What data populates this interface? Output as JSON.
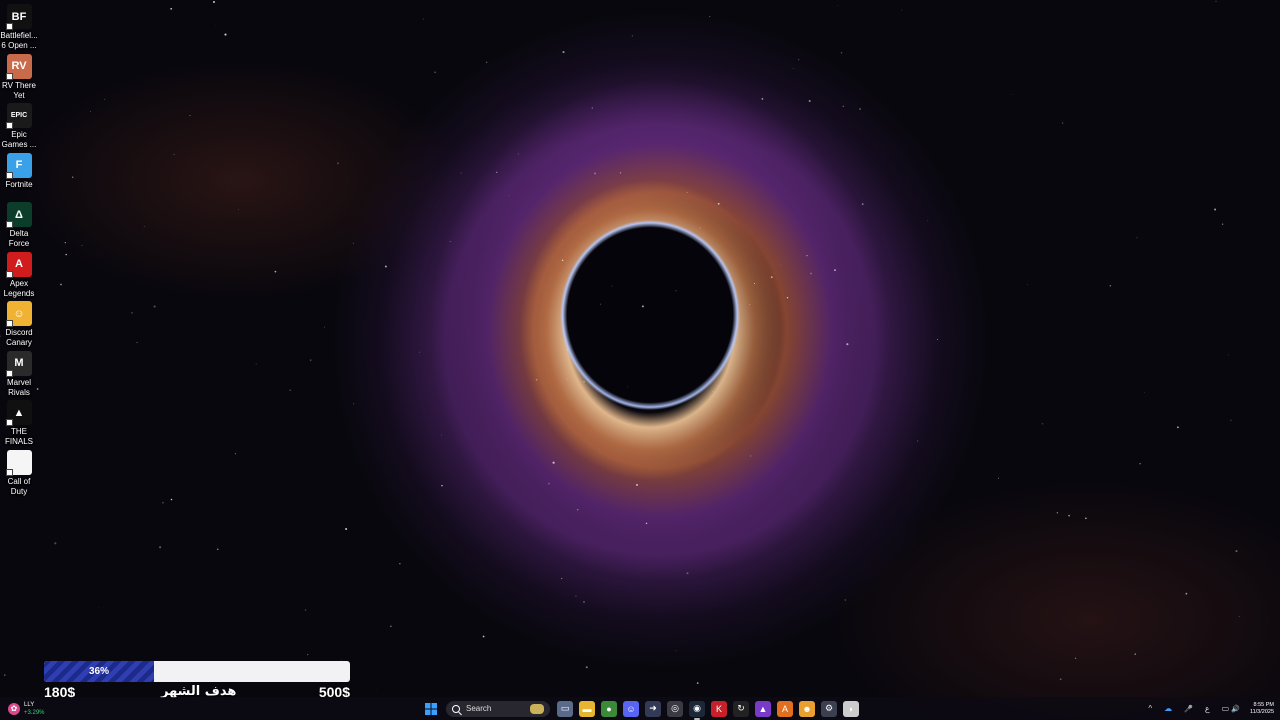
{
  "desktop": {
    "icons": [
      {
        "label": "Battlefiel...\n6 Open ...",
        "glyph": "BF",
        "color": "#111111",
        "icon": "battlefield-icon"
      },
      {
        "label": "RV There\nYet",
        "glyph": "RV",
        "color": "#c86b4a",
        "icon": "rv-there-yet-icon"
      },
      {
        "label": "Epic\nGames ...",
        "glyph": "EPIC",
        "color": "#1a1a1a",
        "icon": "epic-games-icon"
      },
      {
        "label": "Fortnite",
        "glyph": "F",
        "color": "#3aa0e8",
        "icon": "fortnite-icon"
      },
      {
        "label": "Delta\nForce",
        "glyph": "Δ",
        "color": "#0b3d2a",
        "icon": "delta-force-icon"
      },
      {
        "label": "Apex\nLegends",
        "glyph": "A",
        "color": "#d01c1c",
        "icon": "apex-legends-icon"
      },
      {
        "label": "Discord\nCanary",
        "glyph": "☺",
        "color": "#f0b232",
        "icon": "discord-canary-icon"
      },
      {
        "label": "Marvel\nRivals",
        "glyph": "M",
        "color": "#2a2a2a",
        "icon": "marvel-rivals-icon"
      },
      {
        "label": "THE\nFINALS",
        "glyph": "▲",
        "color": "#101010",
        "icon": "the-finals-icon"
      },
      {
        "label": "Call of\nDuty",
        "glyph": "",
        "color": "#f5f5f5",
        "icon": "call-of-duty-file-icon"
      }
    ]
  },
  "goal": {
    "percent_label": "36%",
    "progress": 0.36,
    "current": "180$",
    "label": "هدف الشهر",
    "target": "500$",
    "fill_color": "#2a3aa6",
    "bar_color": "#f2f2f4"
  },
  "taskbar": {
    "stock": {
      "symbol": "LLY",
      "change": "+3.29%"
    },
    "search_label": "Search",
    "apps": [
      {
        "name": "file-manager-icon",
        "glyph": "▭",
        "color": "#5a6a8a",
        "active": false
      },
      {
        "name": "file-explorer-icon",
        "glyph": "▬",
        "color": "#e8b530",
        "active": false
      },
      {
        "name": "chrome-icon",
        "glyph": "●",
        "color": "#3a8a3a",
        "active": false
      },
      {
        "name": "discord-icon",
        "glyph": "☺",
        "color": "#5865f2",
        "active": false
      },
      {
        "name": "app-arrow-icon",
        "glyph": "➜",
        "color": "#333a55",
        "active": false
      },
      {
        "name": "app-disc-icon",
        "glyph": "◎",
        "color": "#3a3a44",
        "active": false
      },
      {
        "name": "steam-icon",
        "glyph": "◉",
        "color": "#1b2838",
        "active": true
      },
      {
        "name": "app-red-icon",
        "glyph": "K",
        "color": "#c8202a",
        "active": false
      },
      {
        "name": "app-refresh-icon",
        "glyph": "↻",
        "color": "#222",
        "active": false
      },
      {
        "name": "app-car-icon",
        "glyph": "▲",
        "color": "#7a3ac8",
        "active": false
      },
      {
        "name": "app-orange-icon",
        "glyph": "A",
        "color": "#e07020",
        "active": false
      },
      {
        "name": "app-avatar-icon",
        "glyph": "☻",
        "color": "#e8a030",
        "active": false
      },
      {
        "name": "settings-icon",
        "glyph": "⚙",
        "color": "#3a4050",
        "active": false
      },
      {
        "name": "app-shield-icon",
        "glyph": "◗",
        "color": "#cccccc",
        "active": false
      }
    ],
    "tray": {
      "chevron": "^",
      "onedrive": "☁",
      "mic": "🎤",
      "lang": "ع",
      "network": "▭",
      "volume": "🔊",
      "time": "8:55 PM",
      "date": "11/3/2025"
    }
  }
}
